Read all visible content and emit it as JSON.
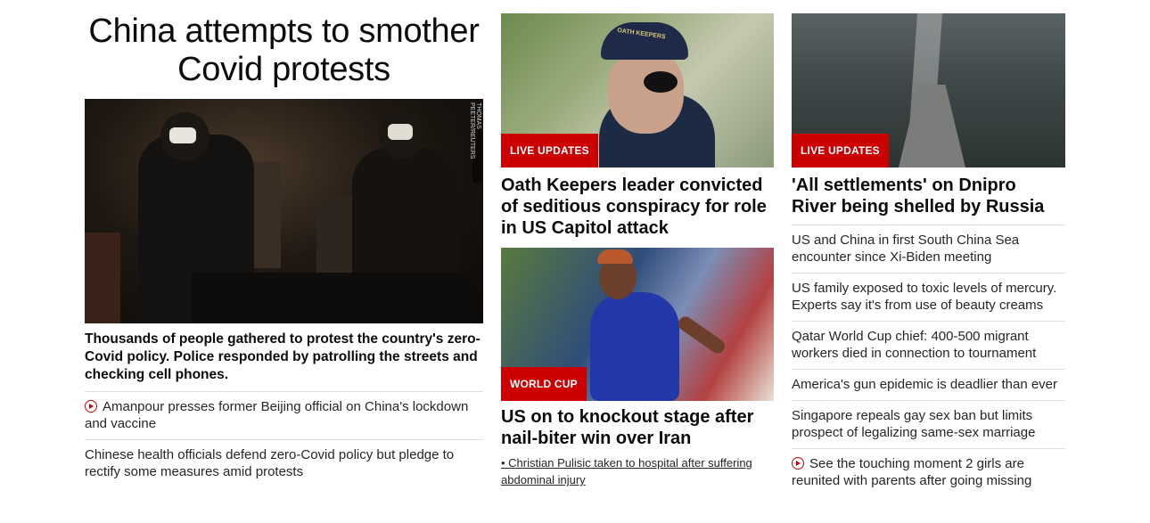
{
  "lead": {
    "headline": "China attempts to smother Covid protests",
    "photo_credit": "THOMAS PEETER/REUTERS",
    "summary": "Thousands of people gathered to protest the country's zero-Covid policy. Police responded by patrolling the streets and checking cell phones.",
    "links": [
      {
        "video": true,
        "text": "Amanpour presses former Beijing official on China's lockdown and vaccine"
      },
      {
        "video": false,
        "text": "Chinese health officials defend zero-Covid policy but pledge to rectify some measures amid protests"
      }
    ]
  },
  "middle": {
    "story1": {
      "badge": "LIVE UPDATES",
      "headline": "Oath Keepers leader convicted of seditious conspiracy for role in US Capitol attack",
      "cap_text": "OATH KEEPERS"
    },
    "story2": {
      "badge": "WORLD CUP",
      "headline": "US on to knockout stage after nail-biter win over Iran",
      "link": "• Christian Pulisic taken to hospital after suffering abdominal injury"
    }
  },
  "right": {
    "story": {
      "badge": "LIVE UPDATES",
      "headline": "'All settlements' on Dnipro River being shelled by Russia"
    },
    "links": [
      {
        "video": false,
        "text": "US and China in first South China Sea encounter since Xi-Biden meeting"
      },
      {
        "video": false,
        "text": "US family exposed to toxic levels of mercury. Experts say it's from use of beauty creams"
      },
      {
        "video": false,
        "text": "Qatar World Cup chief: 400-500 migrant workers died in connection to tournament"
      },
      {
        "video": false,
        "text": "America's gun epidemic is deadlier than ever"
      },
      {
        "video": false,
        "text": "Singapore repeals gay sex ban but limits prospect of legalizing same-sex marriage"
      },
      {
        "video": true,
        "text": "See the touching moment 2 girls are reunited with parents after going missing"
      }
    ]
  },
  "colors": {
    "badge": "#cc0000",
    "text": "#0c0c0c",
    "divider": "#e0e0e0"
  },
  "icons": {
    "video": "play-circle-icon"
  }
}
